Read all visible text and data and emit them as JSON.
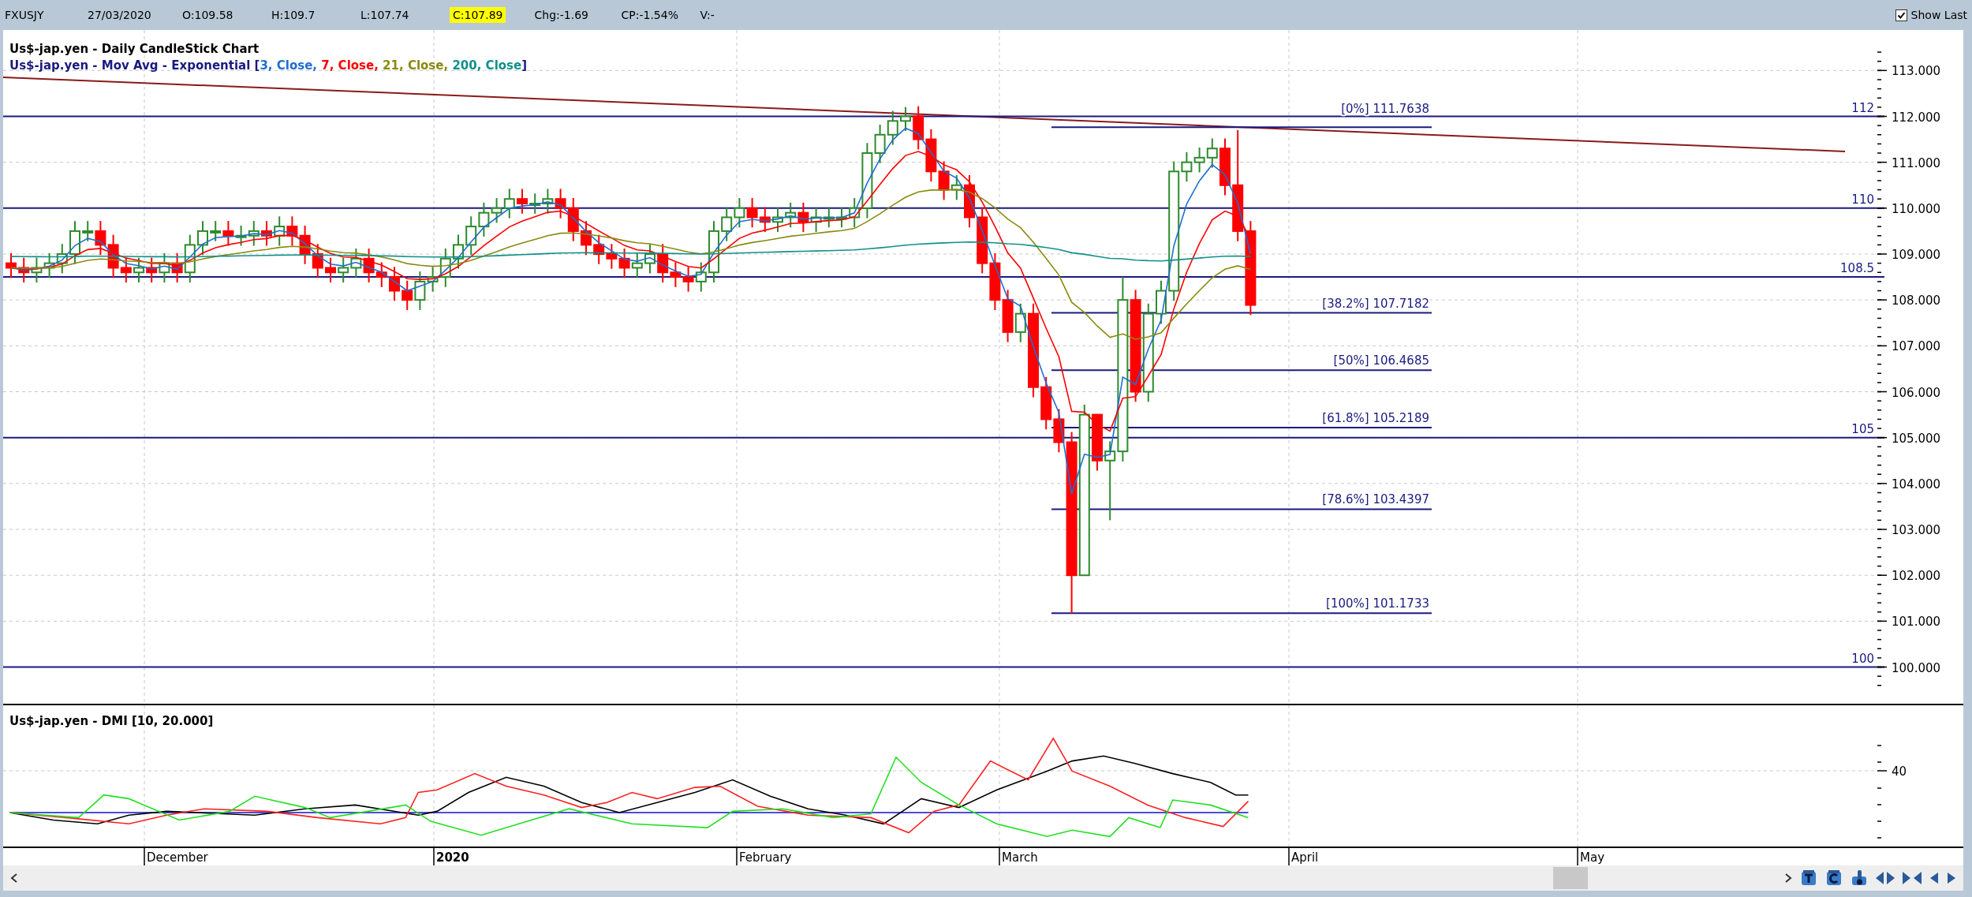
{
  "header": {
    "symbol": "FXUSJY",
    "date": "27/03/2020",
    "open": "O:109.58",
    "high": "H:109.7",
    "low": "L:107.74",
    "close": "C:107.89",
    "change": "Chg:-1.69",
    "change_percent": "CP:-1.54%",
    "volume": "V:-"
  },
  "show_last": {
    "label": "Show Last",
    "checked": true
  },
  "price_chart": {
    "title": "Us$-jap.yen - Daily CandleStick Chart",
    "ma_legend": {
      "prefix": "Us$-jap.yen - Mov Avg - Exponential [",
      "suffix": "]",
      "averages": [
        {
          "label": "3, Close, ",
          "color": "#1f6fd1"
        },
        {
          "label": "7, Close, ",
          "color": "#ff0000"
        },
        {
          "label": "21, Close, ",
          "color": "#8a8a10"
        },
        {
          "label": "200, Close",
          "color": "#10908a"
        }
      ]
    },
    "y_axis": [
      "113.000",
      "112.000",
      "111.000",
      "110.000",
      "109.000",
      "108.000",
      "107.000",
      "106.000",
      "105.000",
      "104.000",
      "103.000",
      "102.000",
      "101.000",
      "100.000"
    ],
    "levels": [
      {
        "label": "112"
      },
      {
        "label": "110"
      },
      {
        "label": "108.5"
      },
      {
        "label": "105"
      },
      {
        "label": "100"
      }
    ],
    "fibonacci": [
      {
        "label": "[0%] 111.7638"
      },
      {
        "label": "[38.2%] 107.7182"
      },
      {
        "label": "[50%] 106.4685"
      },
      {
        "label": "[61.8%] 105.2189"
      },
      {
        "label": "[78.6%] 103.4397"
      },
      {
        "label": "[100%] 101.1733"
      }
    ]
  },
  "dmi_chart": {
    "title": "Us$-jap.yen - DMI [10, 20.000]",
    "y_axis": [
      "40"
    ]
  },
  "months": [
    {
      "label": "December",
      "kind": "month"
    },
    {
      "label": "2020",
      "kind": "year"
    },
    {
      "label": "February",
      "kind": "month"
    },
    {
      "label": "March",
      "kind": "month"
    },
    {
      "label": "April",
      "kind": "month"
    },
    {
      "label": "May",
      "kind": "month"
    }
  ]
}
